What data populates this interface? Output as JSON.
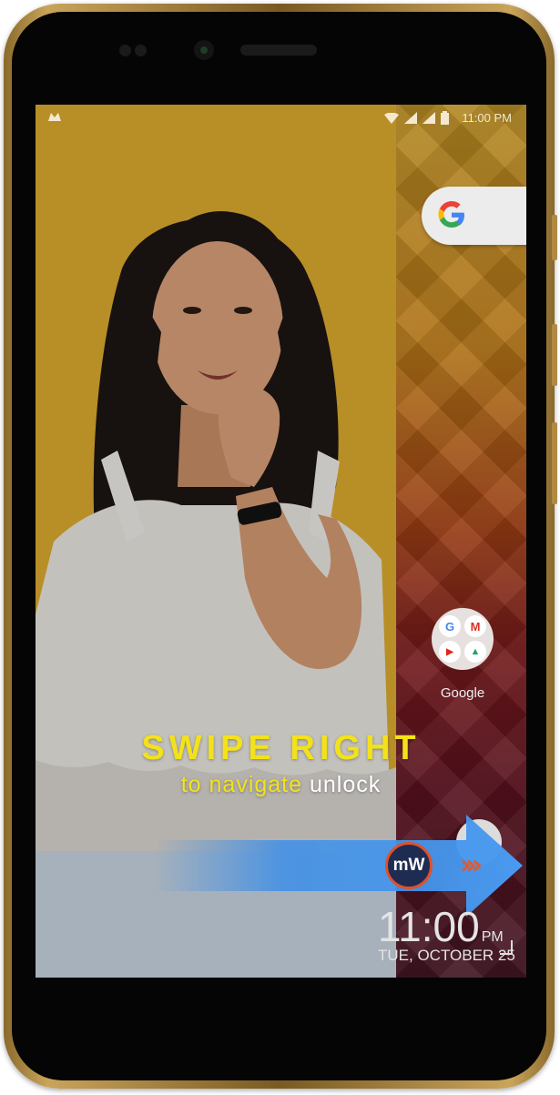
{
  "status_bar": {
    "time": "11:00 PM",
    "left_icon": "notification-icon",
    "icons": [
      "wifi-icon",
      "signal-icon",
      "signal-icon",
      "battery-icon"
    ]
  },
  "home": {
    "search_widget_icon": "google-g-icon",
    "folder_label": "Google",
    "folder_apps": [
      "G",
      "M",
      "▶",
      "▲"
    ]
  },
  "lock_screen": {
    "headline": "SWIPE RIGHT",
    "subline_part1": "to navigate",
    "subline_part2": "unlock",
    "badge_text": "mW",
    "chevrons": "›››",
    "clock_time": "11:00",
    "clock_ampm": "PM",
    "clock_date": "TUE, OCTOBER 25"
  },
  "colors": {
    "headline": "#f3e21a",
    "arrow": "#3d8fe8",
    "photo_bg": "#dcaa2f",
    "phone_gold": "#c9a45a"
  }
}
